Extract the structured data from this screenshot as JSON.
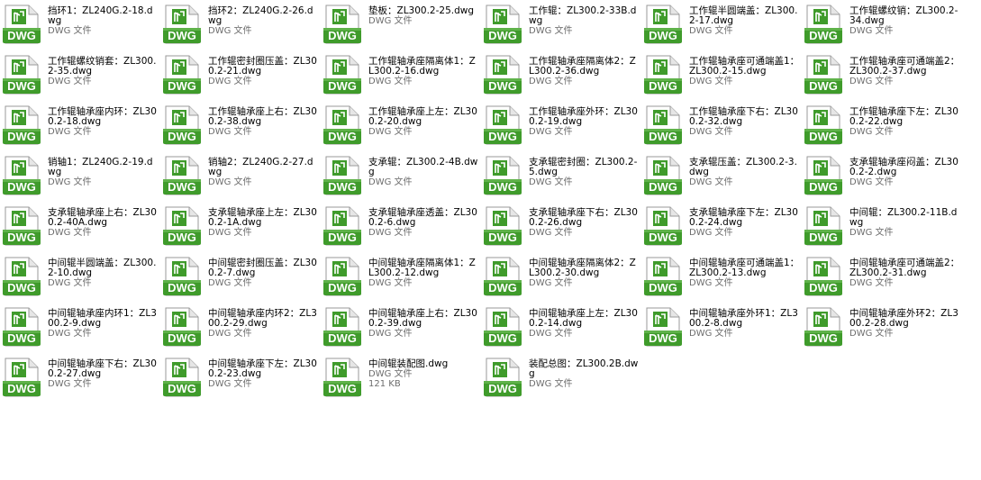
{
  "icon": {
    "name": "dwg-file-icon",
    "label": "DWG",
    "accent": "#3f9b2b",
    "page": "#ffffff",
    "fold": "#c8c8c8"
  },
  "files": [
    {
      "name": "挡环1：ZL240G.2-18.dwg",
      "type": "DWG 文件"
    },
    {
      "name": "挡环2：ZL240G.2-26.dwg",
      "type": "DWG 文件"
    },
    {
      "name": "垫板：ZL300.2-25.dwg",
      "type": "DWG 文件"
    },
    {
      "name": "工作辊：ZL300.2-33B.dwg",
      "type": "DWG 文件"
    },
    {
      "name": "工作辊半圆端盖：ZL300.2-17.dwg",
      "type": "DWG 文件"
    },
    {
      "name": "工作辊螺纹销：ZL300.2-34.dwg",
      "type": "DWG 文件"
    },
    {
      "name": "工作辊螺纹销套：ZL300.2-35.dwg",
      "type": "DWG 文件"
    },
    {
      "name": "工作辊密封圈压盖：ZL300.2-21.dwg",
      "type": "DWG 文件"
    },
    {
      "name": "工作辊轴承座隔离体1：ZL300.2-16.dwg",
      "type": "DWG 文件"
    },
    {
      "name": "工作辊轴承座隔离体2：ZL300.2-36.dwg",
      "type": "DWG 文件"
    },
    {
      "name": "工作辊轴承座可通端盖1：ZL300.2-15.dwg",
      "type": "DWG 文件"
    },
    {
      "name": "工作辊轴承座可通端盖2：ZL300.2-37.dwg",
      "type": "DWG 文件"
    },
    {
      "name": "工作辊轴承座内环：ZL300.2-18.dwg",
      "type": "DWG 文件"
    },
    {
      "name": "工作辊轴承座上右：ZL300.2-38.dwg",
      "type": "DWG 文件"
    },
    {
      "name": "工作辊轴承座上左：ZL300.2-20.dwg",
      "type": "DWG 文件"
    },
    {
      "name": "工作辊轴承座外环：ZL300.2-19.dwg",
      "type": "DWG 文件"
    },
    {
      "name": "工作辊轴承座下右：ZL300.2-32.dwg",
      "type": "DWG 文件"
    },
    {
      "name": "工作辊轴承座下左：ZL300.2-22.dwg",
      "type": "DWG 文件"
    },
    {
      "name": "销轴1：ZL240G.2-19.dwg",
      "type": "DWG 文件"
    },
    {
      "name": "销轴2：ZL240G.2-27.dwg",
      "type": "DWG 文件"
    },
    {
      "name": "支承辊：ZL300.2-4B.dwg",
      "type": "DWG 文件"
    },
    {
      "name": "支承辊密封圈：ZL300.2-5.dwg",
      "type": "DWG 文件"
    },
    {
      "name": "支承辊压盖：ZL300.2-3.dwg",
      "type": "DWG 文件"
    },
    {
      "name": "支承辊轴承座闷盖：ZL300.2-2.dwg",
      "type": "DWG 文件"
    },
    {
      "name": "支承辊轴承座上右：ZL300.2-40A.dwg",
      "type": "DWG 文件"
    },
    {
      "name": "支承辊轴承座上左：ZL300.2-1A.dwg",
      "type": "DWG 文件"
    },
    {
      "name": "支承辊轴承座透盖：ZL300.2-6.dwg",
      "type": "DWG 文件"
    },
    {
      "name": "支承辊轴承座下右：ZL300.2-26.dwg",
      "type": "DWG 文件"
    },
    {
      "name": "支承辊轴承座下左：ZL300.2-24.dwg",
      "type": "DWG 文件"
    },
    {
      "name": "中间辊：ZL300.2-11B.dwg",
      "type": "DWG 文件"
    },
    {
      "name": "中间辊半圆端盖：ZL300.2-10.dwg",
      "type": "DWG 文件"
    },
    {
      "name": "中间辊密封圈压盖：ZL300.2-7.dwg",
      "type": "DWG 文件"
    },
    {
      "name": "中间辊轴承座隔离体1：ZL300.2-12.dwg",
      "type": "DWG 文件"
    },
    {
      "name": "中间辊轴承座隔离体2：ZL300.2-30.dwg",
      "type": "DWG 文件"
    },
    {
      "name": "中间辊轴承座可通端盖1：ZL300.2-13.dwg",
      "type": "DWG 文件"
    },
    {
      "name": "中间辊轴承座可通端盖2：ZL300.2-31.dwg",
      "type": "DWG 文件"
    },
    {
      "name": "中间辊轴承座内环1：ZL300.2-9.dwg",
      "type": "DWG 文件"
    },
    {
      "name": "中间辊轴承座内环2：ZL300.2-29.dwg",
      "type": "DWG 文件"
    },
    {
      "name": "中间辊轴承座上右：ZL300.2-39.dwg",
      "type": "DWG 文件"
    },
    {
      "name": "中间辊轴承座上左：ZL300.2-14.dwg",
      "type": "DWG 文件"
    },
    {
      "name": "中间辊轴承座外环1：ZL300.2-8.dwg",
      "type": "DWG 文件"
    },
    {
      "name": "中间辊轴承座外环2：ZL300.2-28.dwg",
      "type": "DWG 文件"
    },
    {
      "name": "中间辊轴承座下右：ZL300.2-27.dwg",
      "type": "DWG 文件"
    },
    {
      "name": "中间辊轴承座下左：ZL300.2-23.dwg",
      "type": "DWG 文件"
    },
    {
      "name": "中间辊装配图.dwg",
      "type": "DWG 文件",
      "size": "121 KB"
    },
    {
      "name": "装配总图：ZL300.2B.dwg",
      "type": "DWG 文件"
    }
  ]
}
